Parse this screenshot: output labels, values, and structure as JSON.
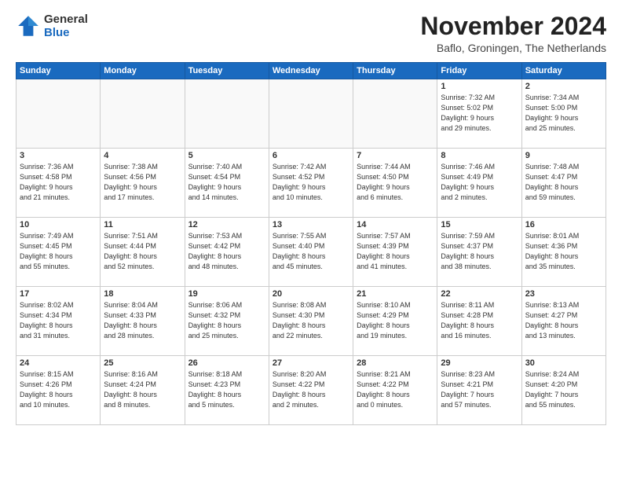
{
  "header": {
    "logo_general": "General",
    "logo_blue": "Blue",
    "month_title": "November 2024",
    "location": "Baflo, Groningen, The Netherlands"
  },
  "weekdays": [
    "Sunday",
    "Monday",
    "Tuesday",
    "Wednesday",
    "Thursday",
    "Friday",
    "Saturday"
  ],
  "weeks": [
    [
      {
        "day": "",
        "info": ""
      },
      {
        "day": "",
        "info": ""
      },
      {
        "day": "",
        "info": ""
      },
      {
        "day": "",
        "info": ""
      },
      {
        "day": "",
        "info": ""
      },
      {
        "day": "1",
        "info": "Sunrise: 7:32 AM\nSunset: 5:02 PM\nDaylight: 9 hours\nand 29 minutes."
      },
      {
        "day": "2",
        "info": "Sunrise: 7:34 AM\nSunset: 5:00 PM\nDaylight: 9 hours\nand 25 minutes."
      }
    ],
    [
      {
        "day": "3",
        "info": "Sunrise: 7:36 AM\nSunset: 4:58 PM\nDaylight: 9 hours\nand 21 minutes."
      },
      {
        "day": "4",
        "info": "Sunrise: 7:38 AM\nSunset: 4:56 PM\nDaylight: 9 hours\nand 17 minutes."
      },
      {
        "day": "5",
        "info": "Sunrise: 7:40 AM\nSunset: 4:54 PM\nDaylight: 9 hours\nand 14 minutes."
      },
      {
        "day": "6",
        "info": "Sunrise: 7:42 AM\nSunset: 4:52 PM\nDaylight: 9 hours\nand 10 minutes."
      },
      {
        "day": "7",
        "info": "Sunrise: 7:44 AM\nSunset: 4:50 PM\nDaylight: 9 hours\nand 6 minutes."
      },
      {
        "day": "8",
        "info": "Sunrise: 7:46 AM\nSunset: 4:49 PM\nDaylight: 9 hours\nand 2 minutes."
      },
      {
        "day": "9",
        "info": "Sunrise: 7:48 AM\nSunset: 4:47 PM\nDaylight: 8 hours\nand 59 minutes."
      }
    ],
    [
      {
        "day": "10",
        "info": "Sunrise: 7:49 AM\nSunset: 4:45 PM\nDaylight: 8 hours\nand 55 minutes."
      },
      {
        "day": "11",
        "info": "Sunrise: 7:51 AM\nSunset: 4:44 PM\nDaylight: 8 hours\nand 52 minutes."
      },
      {
        "day": "12",
        "info": "Sunrise: 7:53 AM\nSunset: 4:42 PM\nDaylight: 8 hours\nand 48 minutes."
      },
      {
        "day": "13",
        "info": "Sunrise: 7:55 AM\nSunset: 4:40 PM\nDaylight: 8 hours\nand 45 minutes."
      },
      {
        "day": "14",
        "info": "Sunrise: 7:57 AM\nSunset: 4:39 PM\nDaylight: 8 hours\nand 41 minutes."
      },
      {
        "day": "15",
        "info": "Sunrise: 7:59 AM\nSunset: 4:37 PM\nDaylight: 8 hours\nand 38 minutes."
      },
      {
        "day": "16",
        "info": "Sunrise: 8:01 AM\nSunset: 4:36 PM\nDaylight: 8 hours\nand 35 minutes."
      }
    ],
    [
      {
        "day": "17",
        "info": "Sunrise: 8:02 AM\nSunset: 4:34 PM\nDaylight: 8 hours\nand 31 minutes."
      },
      {
        "day": "18",
        "info": "Sunrise: 8:04 AM\nSunset: 4:33 PM\nDaylight: 8 hours\nand 28 minutes."
      },
      {
        "day": "19",
        "info": "Sunrise: 8:06 AM\nSunset: 4:32 PM\nDaylight: 8 hours\nand 25 minutes."
      },
      {
        "day": "20",
        "info": "Sunrise: 8:08 AM\nSunset: 4:30 PM\nDaylight: 8 hours\nand 22 minutes."
      },
      {
        "day": "21",
        "info": "Sunrise: 8:10 AM\nSunset: 4:29 PM\nDaylight: 8 hours\nand 19 minutes."
      },
      {
        "day": "22",
        "info": "Sunrise: 8:11 AM\nSunset: 4:28 PM\nDaylight: 8 hours\nand 16 minutes."
      },
      {
        "day": "23",
        "info": "Sunrise: 8:13 AM\nSunset: 4:27 PM\nDaylight: 8 hours\nand 13 minutes."
      }
    ],
    [
      {
        "day": "24",
        "info": "Sunrise: 8:15 AM\nSunset: 4:26 PM\nDaylight: 8 hours\nand 10 minutes."
      },
      {
        "day": "25",
        "info": "Sunrise: 8:16 AM\nSunset: 4:24 PM\nDaylight: 8 hours\nand 8 minutes."
      },
      {
        "day": "26",
        "info": "Sunrise: 8:18 AM\nSunset: 4:23 PM\nDaylight: 8 hours\nand 5 minutes."
      },
      {
        "day": "27",
        "info": "Sunrise: 8:20 AM\nSunset: 4:22 PM\nDaylight: 8 hours\nand 2 minutes."
      },
      {
        "day": "28",
        "info": "Sunrise: 8:21 AM\nSunset: 4:22 PM\nDaylight: 8 hours\nand 0 minutes."
      },
      {
        "day": "29",
        "info": "Sunrise: 8:23 AM\nSunset: 4:21 PM\nDaylight: 7 hours\nand 57 minutes."
      },
      {
        "day": "30",
        "info": "Sunrise: 8:24 AM\nSunset: 4:20 PM\nDaylight: 7 hours\nand 55 minutes."
      }
    ]
  ]
}
